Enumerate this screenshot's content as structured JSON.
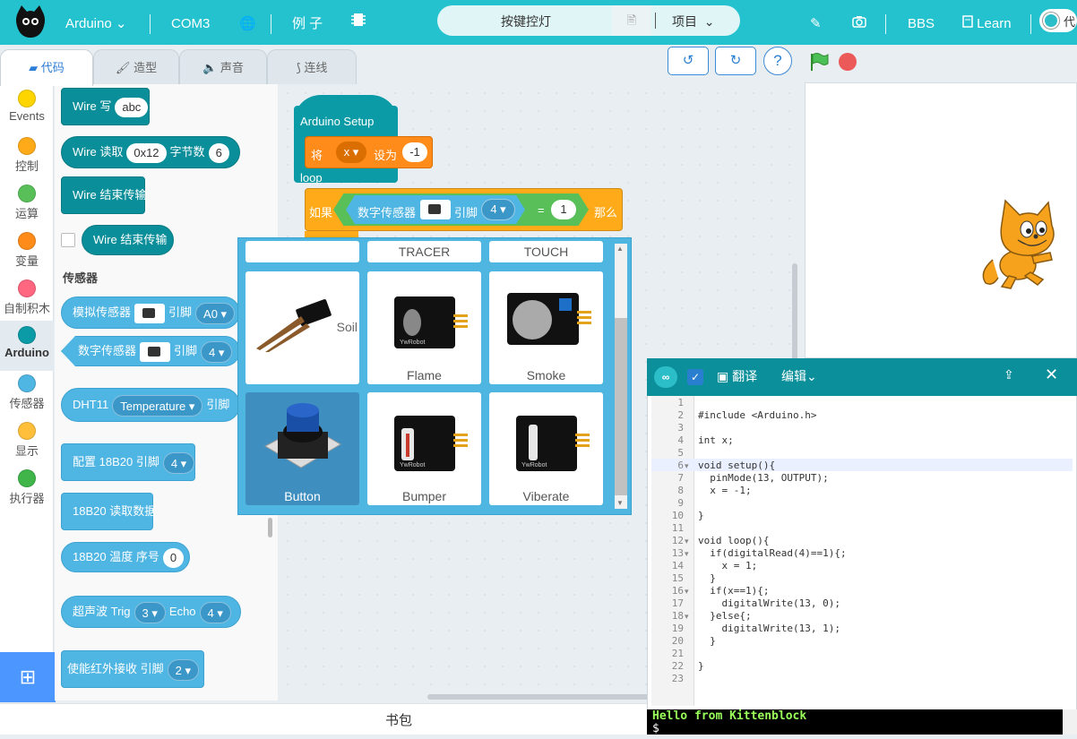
{
  "topbar": {
    "board": "Arduino",
    "port": "COM3",
    "examples": "例 子",
    "project_name": "按键控灯",
    "project_menu": "项目",
    "bbs": "BBS",
    "learn": "Learn",
    "toggle_label": "代"
  },
  "tabs": [
    {
      "label": "代码"
    },
    {
      "label": "造型"
    },
    {
      "label": "声音"
    },
    {
      "label": "连线"
    }
  ],
  "categories": [
    {
      "label": "Events",
      "color": "#ffd500"
    },
    {
      "label": "控制",
      "color": "#ffab19"
    },
    {
      "label": "运算",
      "color": "#59c059"
    },
    {
      "label": "变量",
      "color": "#ff8c1a"
    },
    {
      "label": "自制积木",
      "color": "#ff6680"
    },
    {
      "label": "Arduino",
      "color": "#0a9ba6"
    },
    {
      "label": "传感器",
      "color": "#4fb5e3"
    },
    {
      "label": "显示",
      "color": "#ffbf3a"
    },
    {
      "label": "执行器",
      "color": "#3fb54a"
    }
  ],
  "palette": {
    "wire_write": "Wire 写",
    "wire_write_val": "abc",
    "wire_read": "Wire 读取",
    "wire_read_addr": "0x12",
    "wire_read_bytes_lbl": "字节数",
    "wire_read_bytes": "6",
    "wire_end_1": "Wire 结束传输",
    "wire_end_2": "Wire 结束传输",
    "section_sensors": "传感器",
    "analog_sensor": "模拟传感器",
    "pin_lbl": "引脚",
    "analog_pin": "A0",
    "digital_sensor": "数字传感器",
    "digital_pin": "4",
    "dht11": "DHT11",
    "dht11_type": "Temperature",
    "cfg_18b20": "配置 18B20 引脚",
    "cfg_18b20_pin": "4",
    "read_18b20": "18B20 读取数据",
    "temp_18b20": "18B20 温度 序号",
    "temp_18b20_idx": "0",
    "ultrasonic": "超声波 Trig",
    "trig_val": "3",
    "echo_lbl": "Echo",
    "echo_val": "4",
    "ir_enable": "使能红外接收 引脚",
    "ir_pin": "2"
  },
  "workspace": {
    "setup": "Arduino Setup",
    "set_lbl": "将",
    "set_var": "x",
    "set_to": "设为",
    "set_val": "-1",
    "loop": "loop",
    "if_lbl": "如果",
    "sensor_lbl": "数字传感器",
    "pin_lbl": "引脚",
    "pin_val": "4",
    "eq": "=",
    "cmp_val": "1",
    "then_lbl": "那么"
  },
  "popup": {
    "top_labels": [
      "",
      "TRACER",
      "TOUCH"
    ],
    "cards": [
      {
        "label": "Soil"
      },
      {
        "label": "Flame"
      },
      {
        "label": "Smoke"
      },
      {
        "label": "Button"
      },
      {
        "label": "Bumper"
      },
      {
        "label": "Viberate"
      }
    ]
  },
  "editor": {
    "translate": "翻译",
    "edit": "编辑",
    "code_lines": [
      "",
      "#include <Arduino.h>",
      "",
      "int x;",
      "",
      "void setup(){",
      "  pinMode(13, OUTPUT);",
      "  x = -1;",
      "",
      "}",
      "",
      "void loop(){",
      "  if(digitalRead(4)==1){;",
      "    x = 1;",
      "  }",
      "  if(x==1){;",
      "    digitalWrite(13, 0);",
      "  }else{;",
      "    digitalWrite(13, 1);",
      "  }",
      "",
      "}",
      ""
    ],
    "line_numbers": [
      "1",
      "2",
      "3",
      "4",
      "5",
      "6",
      "7",
      "8",
      "9",
      "10",
      "11",
      "12",
      "13",
      "14",
      "15",
      "16",
      "17",
      "18",
      "19",
      "20",
      "21",
      "22",
      "23"
    ],
    "console_line1": "Hello from Kittenblock",
    "console_line2": "$"
  },
  "bottom": {
    "backpack": "书包"
  }
}
